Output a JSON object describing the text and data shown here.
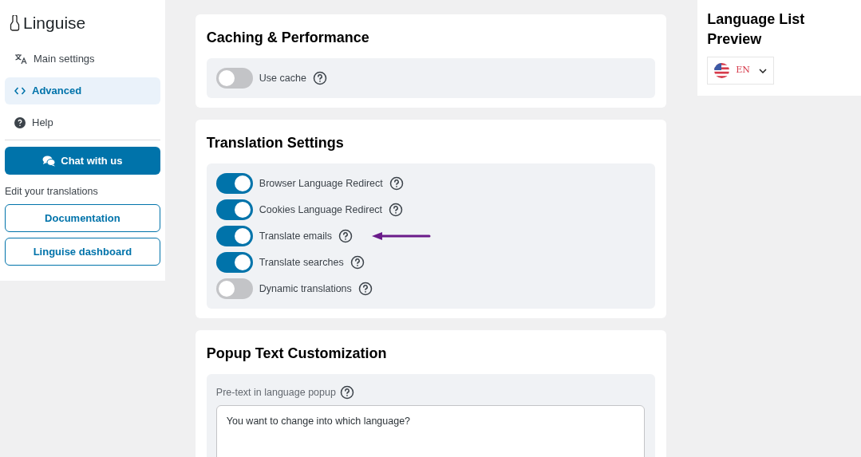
{
  "sidebar": {
    "logo": "Linguise",
    "nav": [
      {
        "label": "Main settings",
        "selected": false
      },
      {
        "label": "Advanced",
        "selected": true
      },
      {
        "label": "Help",
        "selected": false
      }
    ],
    "chat_button": "Chat with us",
    "links_heading": "Edit your translations",
    "links": [
      "Documentation",
      "Linguise dashboard"
    ]
  },
  "sections": [
    {
      "title": "Caching & Performance",
      "toggles": [
        {
          "label": "Use cache",
          "on": false,
          "highlighted": false
        }
      ]
    },
    {
      "title": "Translation Settings",
      "toggles": [
        {
          "label": "Browser Language Redirect",
          "on": true,
          "highlighted": false
        },
        {
          "label": "Cookies Language Redirect",
          "on": true,
          "highlighted": false
        },
        {
          "label": "Translate emails",
          "on": true,
          "highlighted": true
        },
        {
          "label": "Translate searches",
          "on": true,
          "highlighted": false
        },
        {
          "label": "Dynamic translations",
          "on": false,
          "highlighted": false
        }
      ]
    },
    {
      "title": "Popup Text Customization",
      "field": {
        "label": "Pre-text in language popup",
        "value": "You want to change into which language?"
      }
    }
  ],
  "preview": {
    "title": "Language List Preview",
    "language": "EN"
  }
}
